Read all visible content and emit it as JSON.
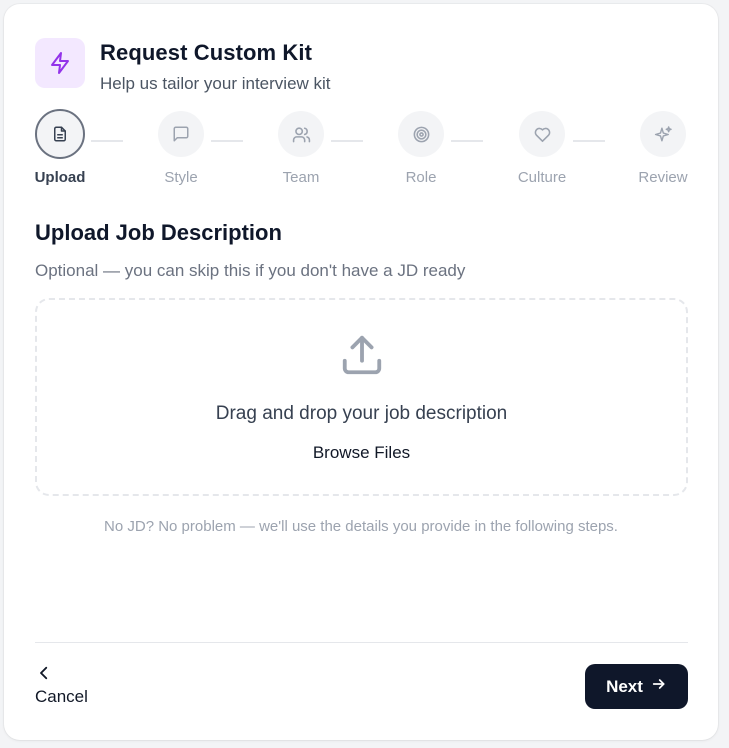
{
  "header": {
    "title": "Request Custom Kit",
    "subtitle": "Help us tailor your interview kit",
    "icon": "lightning-bolt-icon",
    "accent": "#9333ea"
  },
  "steps": [
    {
      "label": "Upload",
      "icon": "document-icon",
      "active": true
    },
    {
      "label": "Style",
      "icon": "message-square-icon",
      "active": false
    },
    {
      "label": "Team",
      "icon": "users-icon",
      "active": false
    },
    {
      "label": "Role",
      "icon": "target-icon",
      "active": false
    },
    {
      "label": "Culture",
      "icon": "heart-icon",
      "active": false
    },
    {
      "label": "Review",
      "icon": "sparkles-icon",
      "active": false
    }
  ],
  "section": {
    "title": "Upload Job Description",
    "subtitle": "Optional — you can skip this if you don't have a JD ready"
  },
  "dropzone": {
    "icon": "upload-icon",
    "text": "Drag and drop your job description",
    "browse_label": "Browse Files"
  },
  "note": "No JD? No problem — we'll use the details you provide in the following steps.",
  "footer": {
    "cancel_label": "Cancel",
    "next_label": "Next",
    "primary_color": "#0f172a"
  }
}
